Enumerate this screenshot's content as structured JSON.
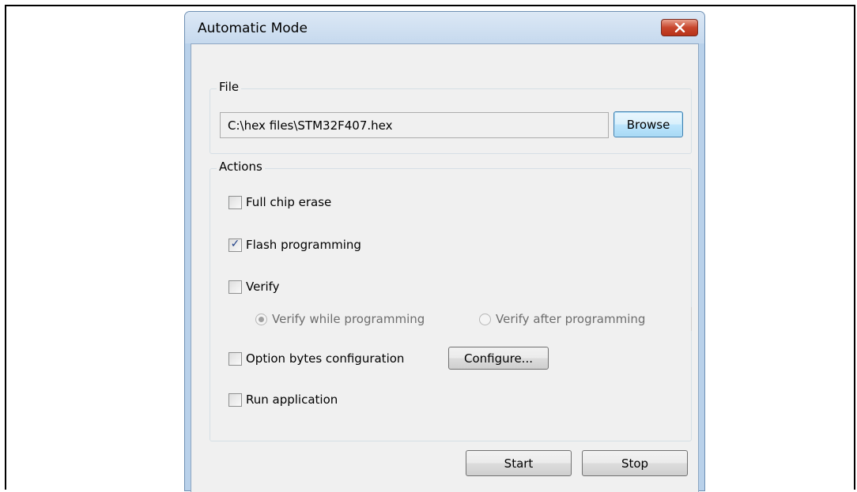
{
  "window": {
    "title": "Automatic Mode",
    "close_icon": "close-icon",
    "accent_color": "#b9d1ea"
  },
  "file_group": {
    "label": "File",
    "path_value": "C:\\hex files\\STM32F407.hex",
    "browse_label": "Browse"
  },
  "actions_group": {
    "label": "Actions",
    "full_chip_erase": {
      "label": "Full chip erase",
      "checked": false
    },
    "flash_programming": {
      "label": "Flash programming",
      "checked": true
    },
    "verify": {
      "label": "Verify",
      "checked": false
    },
    "verify_while": {
      "label": "Verify while programming",
      "selected": true
    },
    "verify_after": {
      "label": "Verify after programming",
      "selected": false
    },
    "option_bytes": {
      "label": "Option bytes configuration",
      "checked": false
    },
    "configure_label": "Configure...",
    "run_application": {
      "label": "Run application",
      "checked": false
    }
  },
  "buttons": {
    "start_label": "Start",
    "stop_label": "Stop"
  }
}
